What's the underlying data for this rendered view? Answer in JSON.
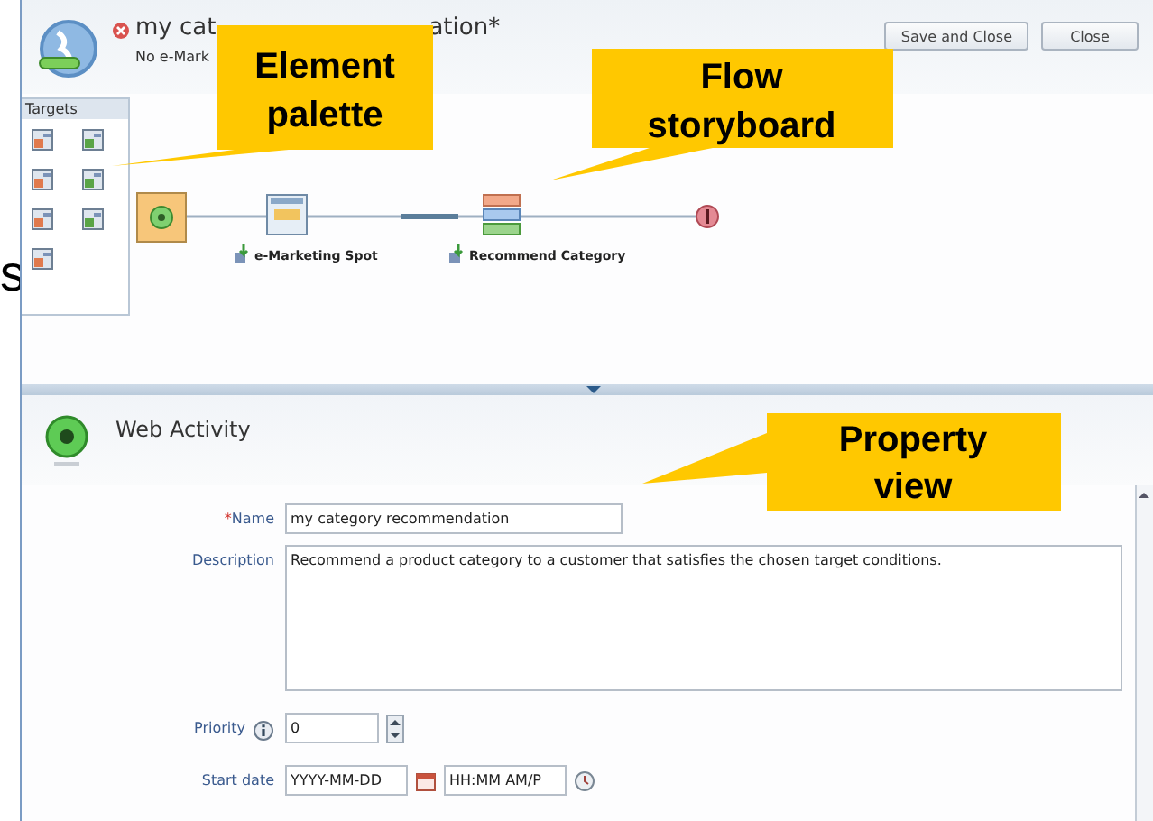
{
  "edge_text": "s",
  "window": {
    "title_start": "my cat",
    "title_end": "ation*",
    "subtitle": "No e-Mark",
    "buttons": [
      "Save and Close",
      "Close"
    ]
  },
  "palette": {
    "title": "Targets"
  },
  "flow": {
    "nodes": [
      {
        "kind": "start"
      },
      {
        "kind": "spot",
        "label": "e-Marketing Spot"
      },
      {
        "kind": "recommend",
        "label": "Recommend Category"
      },
      {
        "kind": "end"
      }
    ]
  },
  "properties": {
    "title": "Web Activity",
    "fields": [
      {
        "kind": "text",
        "required_mark": "*",
        "label": "Name",
        "value": "my category recommendation"
      },
      {
        "kind": "textarea",
        "label": "Description",
        "value": "Recommend a product category to a customer that satisfies the chosen target conditions."
      },
      {
        "kind": "spinner",
        "info": true,
        "label": "Priority",
        "value": "0"
      },
      {
        "kind": "datetime",
        "label": "Start date",
        "date_placeholder": "YYYY-MM-DD",
        "time_placeholder": "HH:MM AM/P"
      }
    ]
  },
  "callouts": [
    {
      "lines": [
        "Element",
        "palette"
      ]
    },
    {
      "lines": [
        "Flow",
        "storyboard"
      ]
    },
    {
      "lines": [
        "Property",
        "view"
      ]
    }
  ]
}
